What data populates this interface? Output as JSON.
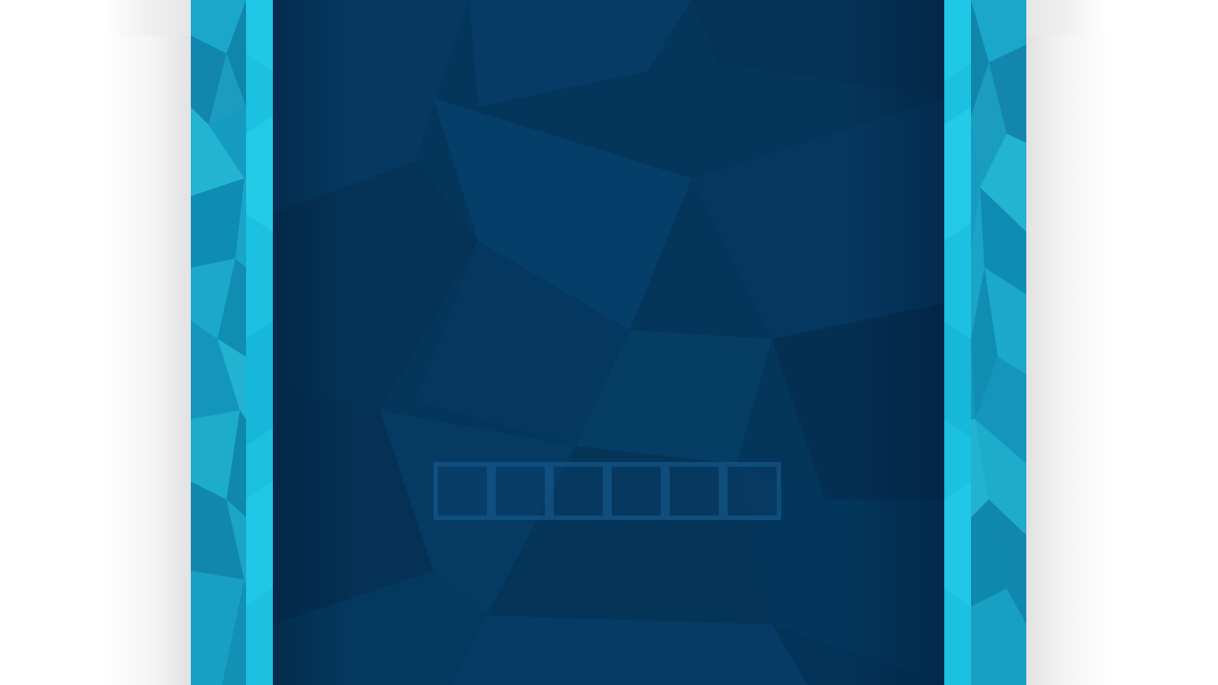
{
  "screen": {
    "loading_indicator": {
      "square_count": 6,
      "active_squares": 0
    }
  },
  "colors": {
    "stage_background": "#04355a",
    "side_panel_base": "#16a6c8",
    "side_panel_highlight": "#22c8e6",
    "loader_square_border": "#165f96",
    "page_background": "#ffffff"
  }
}
